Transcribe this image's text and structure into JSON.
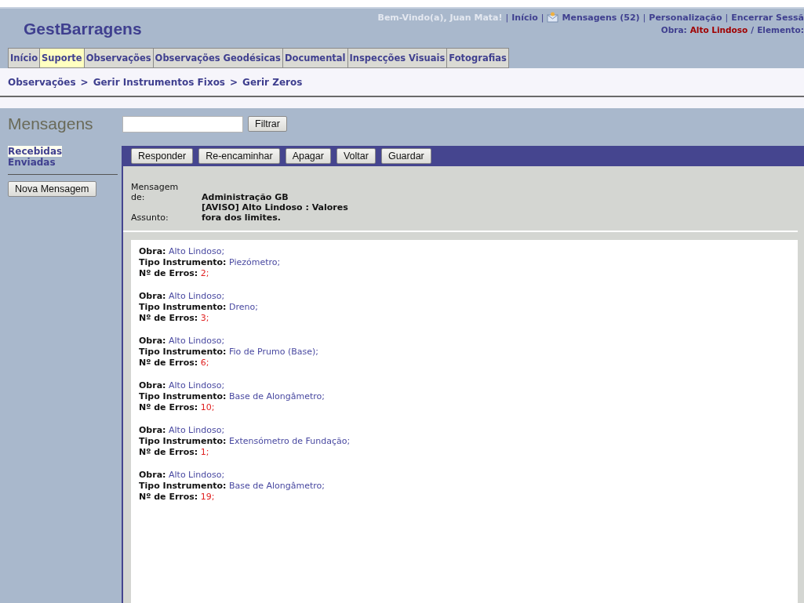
{
  "header": {
    "title": "GestBarragens",
    "welcome": "Bem-Vindo(a), Juan Mata!",
    "links": [
      {
        "label": "Início",
        "icon": false
      },
      {
        "label": "Mensagens (52)",
        "icon": true
      },
      {
        "label": "Personalização",
        "icon": false
      },
      {
        "label": "Encerrar Sessã",
        "icon": false
      }
    ],
    "separator": "|",
    "context": {
      "obra_label": "Obra:",
      "obra": "Alto Lindoso",
      "divider": "/",
      "elemento_label": "Elemento:"
    }
  },
  "tabs": [
    {
      "label": "Início",
      "selected": false
    },
    {
      "label": "Suporte",
      "selected": true
    },
    {
      "label": "Observações",
      "selected": false
    },
    {
      "label": "Observações Geodésicas",
      "selected": false
    },
    {
      "label": "Documental",
      "selected": false
    },
    {
      "label": "Inspecções Visuais",
      "selected": false
    },
    {
      "label": "Fotografias",
      "selected": false
    }
  ],
  "breadcrumb": [
    {
      "label": "Observações",
      "sep": ">"
    },
    {
      "label": "Gerir Instrumentos Fixos",
      "sep": ">"
    },
    {
      "label": "Gerir Zeros"
    }
  ],
  "page_title": "Mensagens",
  "filter": {
    "button": "Filtrar"
  },
  "sidebar": {
    "items": [
      {
        "label": "Recebidas",
        "selected": true
      },
      {
        "label": "Enviadas",
        "selected": false
      }
    ],
    "new_button": "Nova Mensagem"
  },
  "toolbar": [
    "Responder",
    "Re-encaminhar",
    "Apagar",
    "Voltar",
    "Guardar"
  ],
  "message": {
    "from_label": "Mensagem de:",
    "from": "Administração GB",
    "subject_label": "Assunto:",
    "subject": "[AVISO] Alto Lindoso : Valores fora dos limites.",
    "records": [
      {
        "lines": [
          {
            "kind": "info",
            "text": "**Obra:** Alto Lindoso;"
          },
          {
            "kind": "info",
            "text": "**Tipo Instrumento:** Piezómetro;"
          },
          {
            "kind": "error",
            "text": "**Nº de Erros:** 2;"
          }
        ]
      },
      {
        "lines": [
          {
            "kind": "info",
            "text": "**Obra:** Alto Lindoso;"
          },
          {
            "kind": "info",
            "text": "**Tipo Instrumento:** Dreno;"
          },
          {
            "kind": "error",
            "text": "**Nº de Erros:** 3;"
          }
        ]
      },
      {
        "lines": [
          {
            "kind": "info",
            "text": "**Obra:** Alto Lindoso;"
          },
          {
            "kind": "info",
            "text": "**Tipo Instrumento:** Fio de Prumo (Base);"
          },
          {
            "kind": "error",
            "text": "**Nº de Erros:** 6;"
          }
        ]
      },
      {
        "lines": [
          {
            "kind": "info",
            "text": "**Obra:** Alto Lindoso;"
          },
          {
            "kind": "info",
            "text": "**Tipo Instrumento:** Base de Alongâmetro;"
          },
          {
            "kind": "error",
            "text": "**Nº de Erros:** 10;"
          }
        ]
      },
      {
        "lines": [
          {
            "kind": "info",
            "text": "**Obra:** Alto Lindoso;"
          },
          {
            "kind": "info",
            "text": "**Tipo Instrumento:** Extensómetro de Fundação;"
          },
          {
            "kind": "error",
            "text": "**Nº de Erros:** 1;"
          }
        ]
      },
      {
        "lines": [
          {
            "kind": "info",
            "text": "**Obra:** Alto Lindoso;"
          },
          {
            "kind": "info",
            "text": "**Tipo Instrumento:** Base de Alongâmetro;"
          },
          {
            "kind": "error",
            "text": "**Nº de Erros:** 19;"
          }
        ]
      }
    ]
  }
}
